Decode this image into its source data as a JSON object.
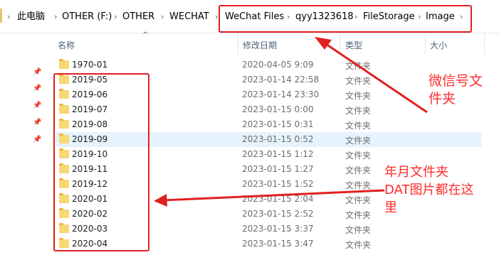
{
  "breadcrumb": [
    "此电脑",
    "OTHER (F:)",
    "OTHER",
    "WECHAT",
    "WeChat Files",
    "qyy1323618",
    "FileStorage",
    "Image"
  ],
  "columns": {
    "name": "名称",
    "date": "修改日期",
    "type": "类型",
    "size": "大小"
  },
  "rows": [
    {
      "name": "1970-01",
      "date": "2020-04-05 9:09",
      "type": "文件夹"
    },
    {
      "name": "2019-05",
      "date": "2023-01-14 22:58",
      "type": "文件夹"
    },
    {
      "name": "2019-06",
      "date": "2023-01-14 23:30",
      "type": "文件夹"
    },
    {
      "name": "2019-07",
      "date": "2023-01-15 0:00",
      "type": "文件夹"
    },
    {
      "name": "2019-08",
      "date": "2023-01-15 0:31",
      "type": "文件夹"
    },
    {
      "name": "2019-09",
      "date": "2023-01-15 0:52",
      "type": "文件夹"
    },
    {
      "name": "2019-10",
      "date": "2023-01-15 1:12",
      "type": "文件夹"
    },
    {
      "name": "2019-11",
      "date": "2023-01-15 1:27",
      "type": "文件夹"
    },
    {
      "name": "2019-12",
      "date": "2023-01-15 1:52",
      "type": "文件夹"
    },
    {
      "name": "2020-01",
      "date": "2023-01-15 2:04",
      "type": "文件夹"
    },
    {
      "name": "2020-02",
      "date": "2023-01-15 2:52",
      "type": "文件夹"
    },
    {
      "name": "2020-03",
      "date": "2023-01-15 3:37",
      "type": "文件夹"
    },
    {
      "name": "2020-04",
      "date": "2023-01-15 3:47",
      "type": "文件夹"
    }
  ],
  "annotations": {
    "wechat_id_folder": [
      "微信号文",
      "件夹"
    ],
    "month_folders": [
      "年月文件夹",
      "DAT图片都在这",
      "里"
    ]
  },
  "icons": {
    "pin": "pin-icon",
    "folder": "folder-icon",
    "separator": "chevron-right-icon",
    "sort": "sort-up-icon"
  },
  "colors": {
    "annotation": "#ff2a2a",
    "selected_row": "#e5f3ff",
    "folder": "#f8d775"
  }
}
